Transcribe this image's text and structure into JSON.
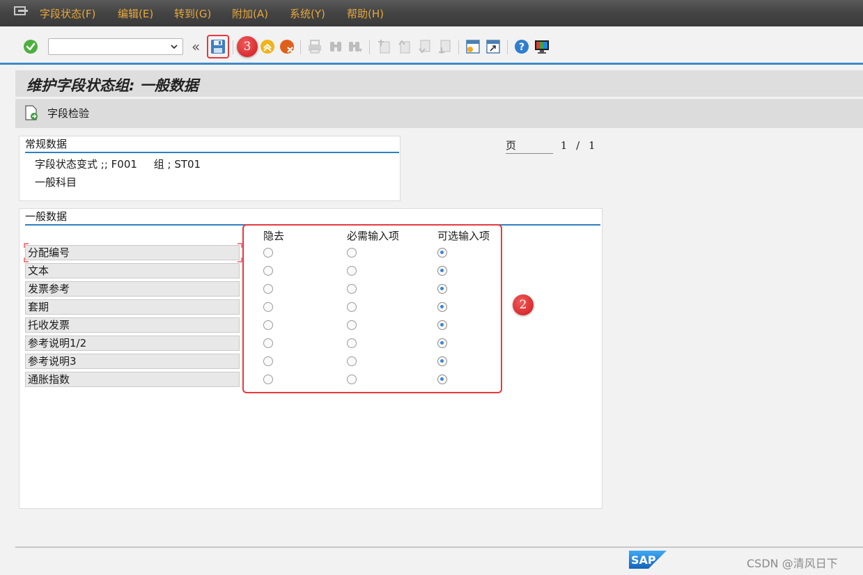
{
  "menu": {
    "items": [
      {
        "label": "字段状态(F)"
      },
      {
        "label": "编辑(E)"
      },
      {
        "label": "转到(G)"
      },
      {
        "label": "附加(A)"
      },
      {
        "label": "系统(Y)"
      },
      {
        "label": "帮助(H)"
      }
    ]
  },
  "toolbar": {
    "command_value": "",
    "collapse_glyph": "«",
    "save_badge": "3"
  },
  "page": {
    "title": "维护字段状态组: 一般数据",
    "app_button_label": "字段检验",
    "page_label": "页",
    "page_current": "1",
    "page_sep": "/",
    "page_total": "1"
  },
  "general_section": {
    "heading": "常规数据",
    "variant_line": "字段状态变式 ;; F001     组 ; ST01",
    "group_text": "一般科目"
  },
  "fields_section": {
    "heading": "一般数据",
    "columns": [
      "隐去",
      "必需输入项",
      "可选输入项"
    ],
    "rows": [
      {
        "label": "分配编号",
        "selected": "可选输入项"
      },
      {
        "label": "文本",
        "selected": "可选输入项"
      },
      {
        "label": "发票参考",
        "selected": "可选输入项"
      },
      {
        "label": "套期",
        "selected": "可选输入项"
      },
      {
        "label": "托收发票",
        "selected": "可选输入项"
      },
      {
        "label": "参考说明1/2",
        "selected": "可选输入项"
      },
      {
        "label": "参考说明3",
        "selected": "可选输入项"
      },
      {
        "label": "通胀指数",
        "selected": "可选输入项"
      }
    ],
    "highlight_badge": "2"
  },
  "footer": {
    "sap_logo": "SAP",
    "watermark": "CSDN @清风日下"
  },
  "colors": {
    "menu_text": "#e7a83c",
    "accent_blue": "#3f8bc9",
    "annotation_red": "#e8383d"
  }
}
